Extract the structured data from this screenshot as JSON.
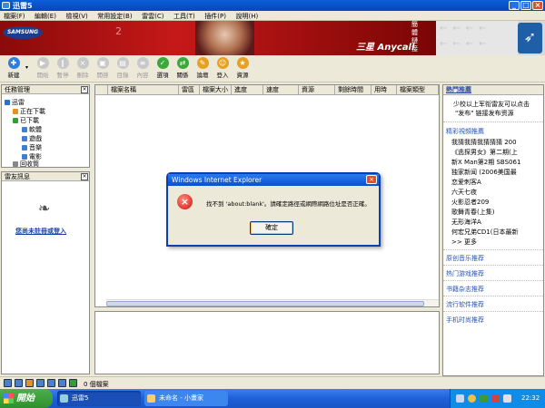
{
  "window": {
    "title": "迅雷5"
  },
  "menu": [
    "檔案(F)",
    "編輯(E)",
    "檢視(V)",
    "常用設定(B)",
    "雷雲(C)",
    "工具(T)",
    "插件(P)",
    "說明(H)"
  ],
  "banner": {
    "logo_text": "SAMSUNG",
    "number": "2",
    "brand": "三星 Anycall",
    "side_text": "簡 體 鏈 接"
  },
  "toolbar": [
    {
      "label": "新建",
      "icon": "new-icon",
      "enabled": true
    },
    {
      "label": "開始",
      "icon": "play-icon",
      "enabled": false
    },
    {
      "label": "暫停",
      "icon": "pause-icon",
      "enabled": false
    },
    {
      "label": "刪除",
      "icon": "delete-icon",
      "enabled": false
    },
    {
      "label": "開啓",
      "icon": "open-icon",
      "enabled": false
    },
    {
      "label": "目錄",
      "icon": "folder-icon",
      "enabled": false
    },
    {
      "label": "內容",
      "icon": "properties-icon",
      "enabled": false
    },
    {
      "label": "選項",
      "icon": "options-icon",
      "enabled": true
    },
    {
      "label": "關係",
      "icon": "relations-icon",
      "enabled": true
    },
    {
      "label": "論壇",
      "icon": "forum-icon",
      "enabled": true
    },
    {
      "label": "登入",
      "icon": "login-icon",
      "enabled": true
    },
    {
      "label": "資源",
      "icon": "resources-icon",
      "enabled": true
    }
  ],
  "task_panel": {
    "title": "任務管理",
    "tree": {
      "root": "迅雷",
      "downloading": "正在下載",
      "completed": "已下載",
      "software": "軟體",
      "games": "遊戲",
      "music": "音樂",
      "movies": "電影",
      "recycle": "回收筒"
    }
  },
  "thunder_panel": {
    "title": "雷友訊息",
    "login_link": "您尚未註冊或登入"
  },
  "columns": [
    "檔案名稱",
    "雷區",
    "檔案大小",
    "進度",
    "速度",
    "資源",
    "剩餘時間",
    "用時",
    "檔案類型"
  ],
  "hot_panel": {
    "title": "熱門推薦",
    "intro": [
      "少校以上军衔雷友可以点击",
      "\"发布\" 链接发布资源"
    ],
    "video_title": "精彩視頻推薦",
    "videos": [
      "我猜我猜我猜猜猜 200",
      "《逃探男女》第二期(上",
      "新X Man第2期 SBS061",
      "独家新闻 (2006美国最",
      "恋爱刺客A",
      "六天七夜",
      "火影忍者209",
      "歌舞青春(上集)",
      "无形海洋A",
      "何宏兄弟CD1(日本最新"
    ],
    "more": "更多",
    "links": [
      "原创音乐推荐",
      "热门游戏推荐",
      "书籍杂志推荐",
      "流行软件推荐",
      "手机时尚推荐"
    ]
  },
  "status": {
    "text": "0 個檔案"
  },
  "dialog": {
    "title": "Windows Internet Explorer",
    "message": "找不到 'about:blank'。請確定路徑或網際網路位址是否正確。",
    "ok": "確定"
  },
  "taskbar": {
    "start": "開始",
    "tasks": [
      "迅雷5",
      "未命名 - 小畫家"
    ],
    "clock": "22:32"
  }
}
